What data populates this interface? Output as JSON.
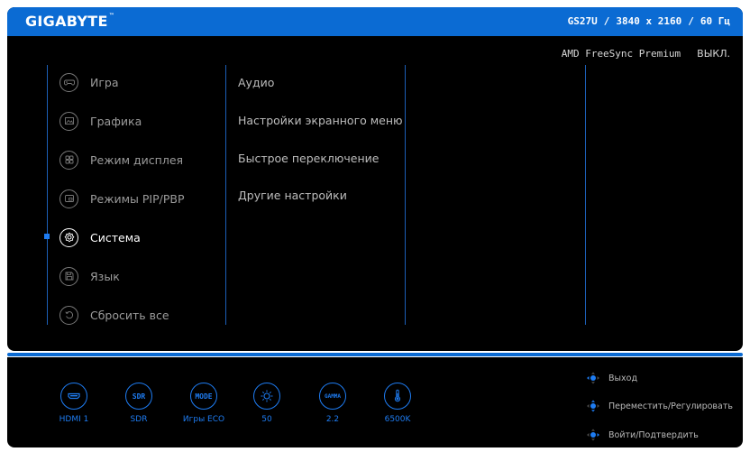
{
  "header": {
    "brand": "GIGABYTE",
    "brand_mark": "™",
    "model": "GS27U",
    "resolution": "3840 x 2160",
    "refresh": "60 Гц",
    "separator": "/"
  },
  "status": {
    "feature": "AMD FreeSync Premium",
    "value": "ВЫКЛ."
  },
  "menu": {
    "items": [
      {
        "label": "Игра",
        "icon": "gamepad-icon"
      },
      {
        "label": "Графика",
        "icon": "picture-icon"
      },
      {
        "label": "Режим дисплея",
        "icon": "display-mode-icon"
      },
      {
        "label": "Режимы PIP/PBP",
        "icon": "pip-icon"
      },
      {
        "label": "Система",
        "icon": "gear-icon",
        "active": true
      },
      {
        "label": "Язык",
        "icon": "floppy-icon"
      },
      {
        "label": "Сбросить все",
        "icon": "reset-icon"
      }
    ]
  },
  "submenu": {
    "items": [
      {
        "label": "Аудио"
      },
      {
        "label": "Настройки экранного меню"
      },
      {
        "label": "Быстрое переключение"
      },
      {
        "label": "Другие настройки"
      }
    ]
  },
  "quick": {
    "items": [
      {
        "label": "HDMI 1",
        "icon": "hdmi-icon"
      },
      {
        "label": "SDR",
        "icon_text": "SDR"
      },
      {
        "label": "Игры ECO",
        "icon_text": "MODE"
      },
      {
        "label": "50",
        "icon": "brightness-icon"
      },
      {
        "label": "2.2",
        "icon_text": "GAMMA"
      },
      {
        "label": "6500K",
        "icon": "thermometer-icon"
      }
    ]
  },
  "hints": {
    "exit": "Выход",
    "move": "Переместить/Регулировать",
    "enter": "Войти/Подтвердить"
  },
  "colors": {
    "accent": "#0b6bd3",
    "highlight": "#1e7cf2",
    "background": "#000000"
  }
}
